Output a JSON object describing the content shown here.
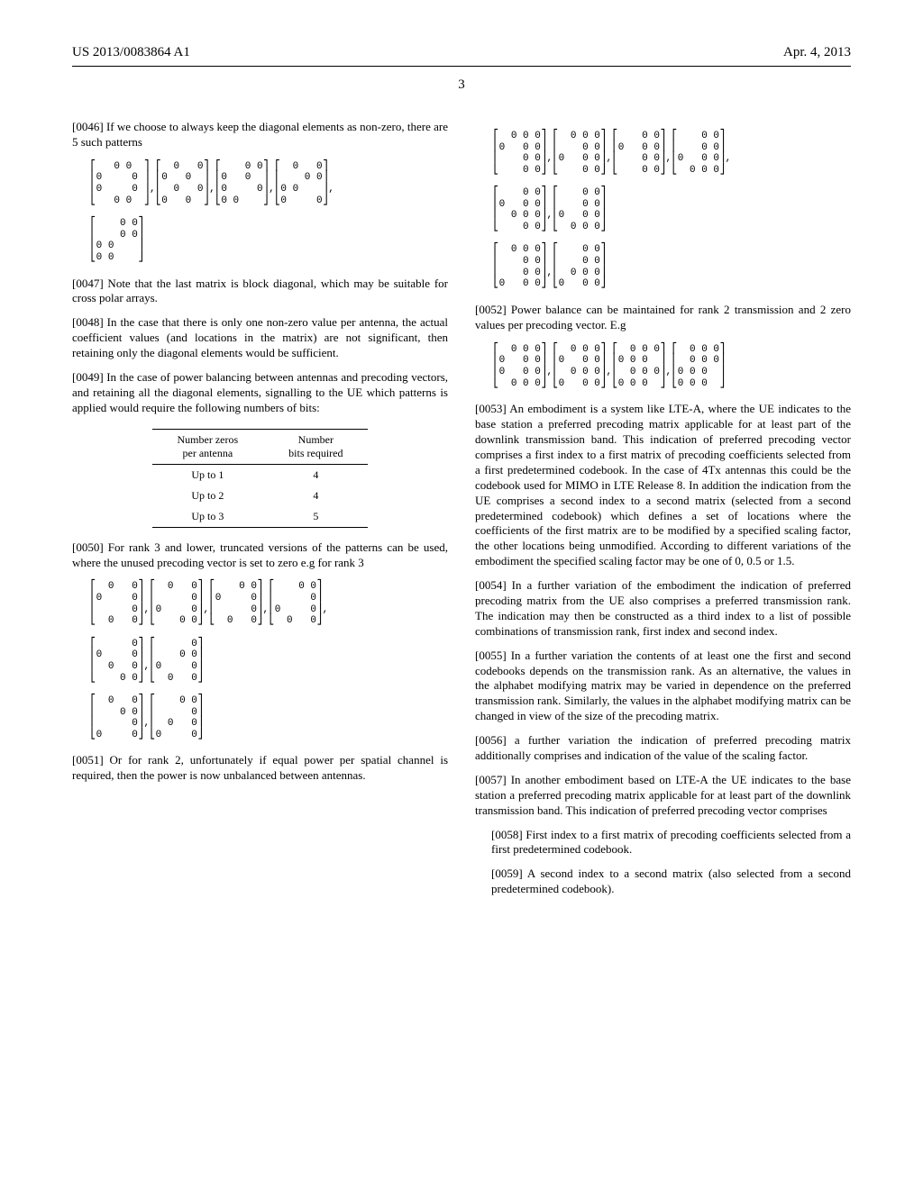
{
  "header": {
    "pub_number": "US 2013/0083864 A1",
    "date": "Apr. 4, 2013",
    "page_number": "3"
  },
  "left": {
    "p0046": "[0046]   If we choose to always keep the diagonal elements as non-zero, there are 5 such patterns",
    "matrix_set_1": "⎡   0 0  ⎤ ⎡  0   0⎤ ⎡    0 0⎤ ⎡  0   0⎤\n⎢0     0 ⎥ ⎢0   0  ⎥ ⎢0   0  ⎥ ⎢    0 0⎥\n⎢0     0 ⎥,⎢  0   0⎥,⎢0     0⎥,⎢0 0    ⎥,\n⎣   0 0  ⎦ ⎣0   0  ⎦ ⎣0 0    ⎦ ⎣0     0⎦\n\n⎡    0 0⎤\n⎢    0 0⎥\n⎢0 0    ⎥\n⎣0 0    ⎦",
    "p0047": "[0047]   Note that the last matrix is block diagonal, which may be suitable for cross polar arrays.",
    "p0048": "[0048]   In the case that there is only one non-zero value per antenna, the actual coefficient values (and locations in the matrix) are not significant, then retaining only the diagonal elements would be sufficient.",
    "p0049": "[0049]   In the case of power balancing between antennas and precoding vectors, and retaining all the diagonal elements, signalling to the UE which patterns is applied would require the following numbers of bits:",
    "table": {
      "headers": [
        "Number zeros\nper antenna",
        "Number\nbits required"
      ],
      "rows": [
        [
          "Up to 1",
          "4"
        ],
        [
          "Up to 2",
          "4"
        ],
        [
          "Up to 3",
          "5"
        ]
      ]
    },
    "p0050": "[0050]   For rank 3 and lower, truncated versions of the patterns can be used, where the unused precoding vector is set to zero e.g for rank 3",
    "matrix_set_2": "⎡  0   0⎤ ⎡  0   0⎤ ⎡    0 0⎤ ⎡    0 0⎤\n⎢0     0⎥ ⎢      0⎥ ⎢0     0⎥ ⎢      0⎥\n⎢      0⎥,⎢0     0⎥,⎢      0⎥,⎢0     0⎥,\n⎣  0   0⎦ ⎣    0 0⎦ ⎣  0   0⎦ ⎣  0   0⎦\n\n⎡      0⎤ ⎡      0⎤\n⎢0     0⎥ ⎢    0 0⎥\n⎢  0   0⎥,⎢0     0⎥\n⎣    0 0⎦ ⎣  0   0⎦\n\n⎡  0   0⎤ ⎡    0 0⎤\n⎢    0 0⎥ ⎢      0⎥\n⎢      0⎥,⎢  0   0⎥\n⎣0     0⎦ ⎣0     0⎦",
    "p0051": "[0051]   Or for rank 2, unfortunately if equal power per spatial channel is required, then the power is now unbalanced between antennas."
  },
  "right": {
    "matrix_set_3": "⎡  0 0 0⎤ ⎡  0 0 0⎤ ⎡    0 0⎤ ⎡    0 0⎤\n⎢0   0 0⎥ ⎢    0 0⎥ ⎢0   0 0⎥ ⎢    0 0⎥\n⎢    0 0⎥,⎢0   0 0⎥,⎢    0 0⎥,⎢0   0 0⎥,\n⎣    0 0⎦ ⎣    0 0⎦ ⎣    0 0⎦ ⎣  0 0 0⎦\n\n⎡    0 0⎤ ⎡    0 0⎤\n⎢0   0 0⎥ ⎢    0 0⎥\n⎢  0 0 0⎥,⎢0   0 0⎥\n⎣    0 0⎦ ⎣  0 0 0⎦\n\n⎡  0 0 0⎤ ⎡    0 0⎤\n⎢    0 0⎥ ⎢    0 0⎥\n⎢    0 0⎥,⎢  0 0 0⎥\n⎣0   0 0⎦ ⎣0   0 0⎦",
    "p0052": "[0052]   Power balance can be maintained for rank 2 transmission and 2 zero values per precoding vector. E.g",
    "matrix_set_4": "⎡  0 0 0⎤ ⎡  0 0 0⎤ ⎡  0 0 0⎤ ⎡  0 0 0⎤\n⎢0   0 0⎥ ⎢0   0 0⎥ ⎢0 0 0  ⎥ ⎢  0 0 0⎥\n⎢0   0 0⎥,⎢  0 0 0⎥,⎢  0 0 0⎥,⎢0 0 0  ⎥\n⎣  0 0 0⎦ ⎣0   0 0⎦ ⎣0 0 0  ⎦ ⎣0 0 0  ⎦",
    "p0053": "[0053]   An embodiment is a system like LTE-A, where the UE indicates to the base station a preferred precoding matrix applicable for at least part of the downlink transmission band. This indication of preferred precoding vector comprises a first index to a first matrix of precoding coefficients selected from a first predetermined codebook. In the case of 4Tx antennas this could be the codebook used for MIMO in LTE Release 8. In addition the indication from the UE comprises a second index to a second matrix (selected from a second predetermined codebook) which defines a set of locations where the coefficients of the first matrix are to be modified by a specified scaling factor, the other locations being unmodified. According to different variations of the embodiment the specified scaling factor may be one of 0, 0.5 or 1.5.",
    "p0054": "[0054]   In a further variation of the embodiment the indication of preferred precoding matrix from the UE also comprises a preferred transmission rank. The indication may then be constructed as a third index to a list of possible combinations of transmission rank, first index and second index.",
    "p0055": "[0055]   In a further variation the contents of at least one the first and second codebooks depends on the transmission rank. As an alternative, the values in the alphabet modifying matrix may be varied in dependence on the preferred transmission rank. Similarly, the values in the alphabet modifying matrix can be changed in view of the size of the precoding matrix.",
    "p0056": "[0056]   a further variation the indication of preferred precoding matrix additionally comprises and indication of the value of the scaling factor.",
    "p0057": "[0057]   In another embodiment based on LTE-A the UE indicates to the base station a preferred precoding matrix applicable for at least part of the downlink transmission band. This indication of preferred precoding vector comprises",
    "p0058": "[0058]   First index to a first matrix of precoding coefficients selected from a first predetermined codebook.",
    "p0059": "[0059]   A second index to a second matrix (also selected from a second predetermined codebook)."
  }
}
